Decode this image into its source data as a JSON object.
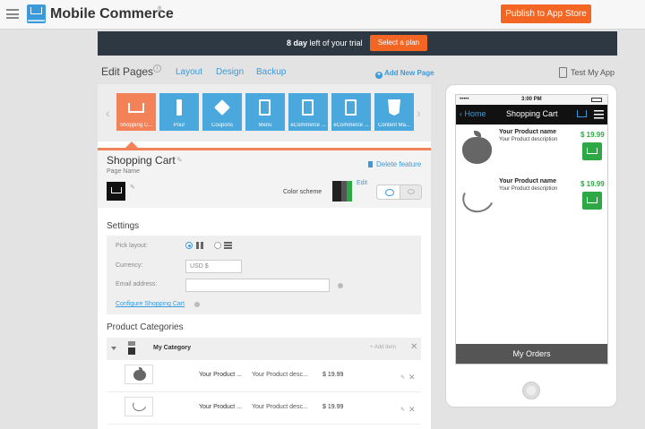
{
  "header": {
    "app_title": "Mobile Commerce",
    "publish_label": "Publish to App Store"
  },
  "trial": {
    "days": "8 day",
    "text": " left of your trial",
    "plan_label": "Select a plan"
  },
  "tabs": {
    "edit_pages": "Edit Pages",
    "layout": "Layout",
    "design": "Design",
    "backup": "Backup",
    "add_new_page": "Add New Page",
    "test_my_app": "Test My App"
  },
  "pages": [
    {
      "label": "Shopping C...",
      "icon": "cart-icon"
    },
    {
      "label": "Pour",
      "icon": "plug-icon"
    },
    {
      "label": "Coupons",
      "icon": "tag-icon"
    },
    {
      "label": "Menu",
      "icon": "document-icon"
    },
    {
      "label": "eCommerce ...",
      "icon": "document-icon"
    },
    {
      "label": "eCommerce ...",
      "icon": "document-icon"
    },
    {
      "label": "Content Ma...",
      "icon": "html5-icon"
    }
  ],
  "feature": {
    "title": "Shopping Cart",
    "subtitle": "Page Name",
    "delete_label": "Delete feature",
    "color_scheme_label": "Color scheme",
    "edit_label": "Edit"
  },
  "settings": {
    "title": "Settings",
    "pick_layout_label": "Pick layout:",
    "currency_label": "Currency:",
    "currency_value": "USD $",
    "email_label": "Email address:",
    "email_value": "",
    "configure_link": "Configure Shopping Cart"
  },
  "categories": {
    "title": "Product Categories",
    "category_name": "My Category",
    "add_item": "+ Add Item",
    "rows": [
      {
        "name": "Your Product ...",
        "desc": "Your Product desc...",
        "price": "$ 19.99",
        "image": "apple"
      },
      {
        "name": "Your Product ...",
        "desc": "Your Product desc...",
        "price": "$ 19.99",
        "image": "banana"
      }
    ]
  },
  "phone": {
    "time": "3:00 PM",
    "back_label": "Home",
    "nav_title": "Shopping Cart",
    "items": [
      {
        "name": "Your Product name",
        "desc": "Your Product description",
        "price": "$ 19.99",
        "image": "apple"
      },
      {
        "name": "Your Product name",
        "desc": "Your Product description",
        "price": "$ 19.99",
        "image": "banana"
      }
    ],
    "orders_label": "My Orders"
  },
  "colors": {
    "accent_orange": "#f26522",
    "accent_blue": "#3b9ad9",
    "price_green": "#2ea844",
    "banner_dark": "#2e3842"
  }
}
